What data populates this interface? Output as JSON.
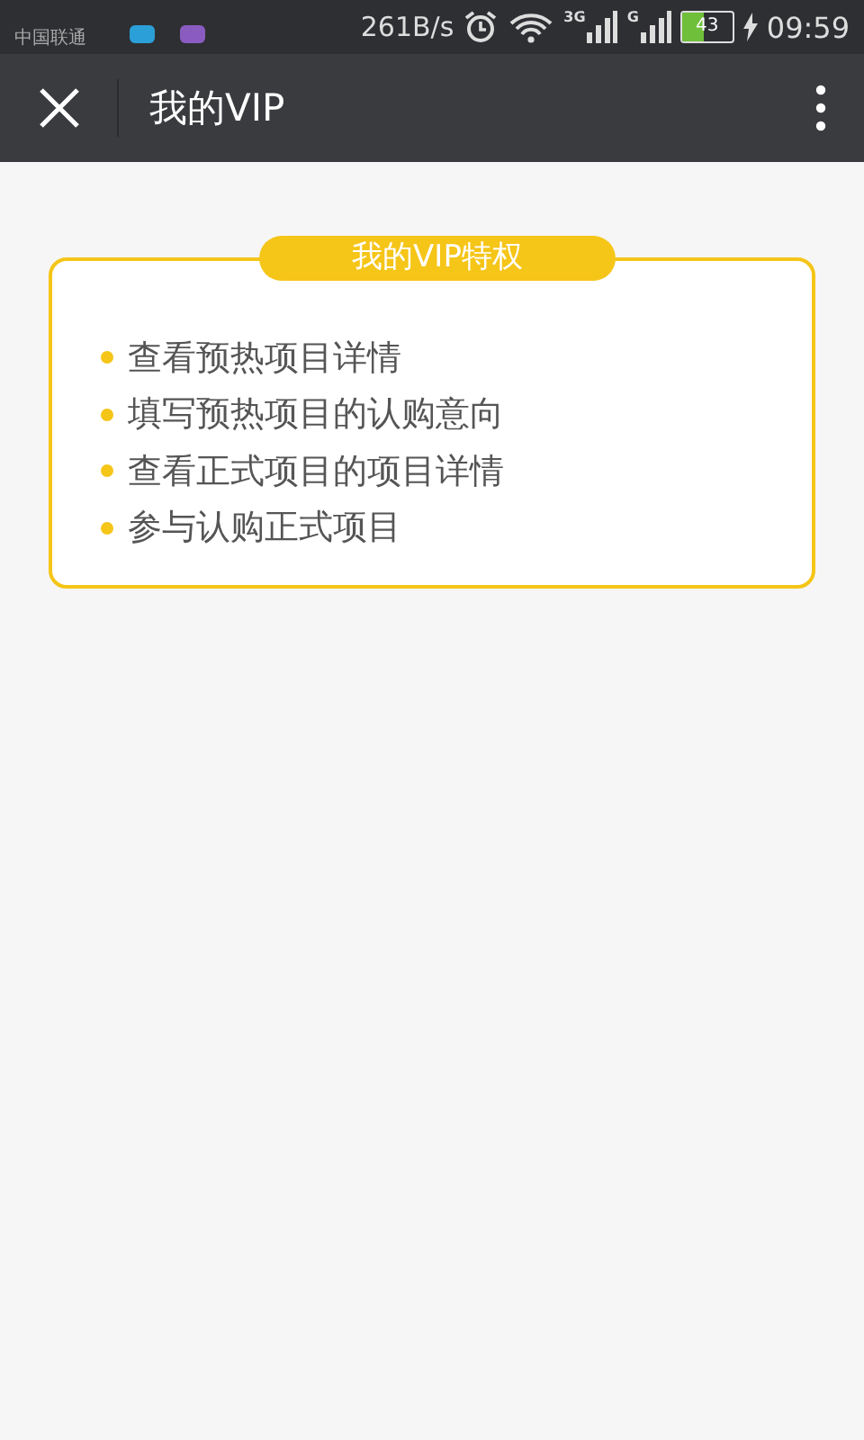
{
  "status_bar": {
    "carrier": "中国联通",
    "network_speed": "261B/s",
    "signal_labels": [
      "3G",
      "G"
    ],
    "battery": "43",
    "charging": true,
    "time": "09:59"
  },
  "toolbar": {
    "close": true,
    "title": "我的VIP",
    "menu": true
  },
  "vip_card": {
    "heading": "我的VIP特权",
    "items": [
      "查看预热项目详情",
      "填写预热项目的认购意向",
      "查看正式项目的项目详情",
      "参与认购正式项目"
    ]
  }
}
